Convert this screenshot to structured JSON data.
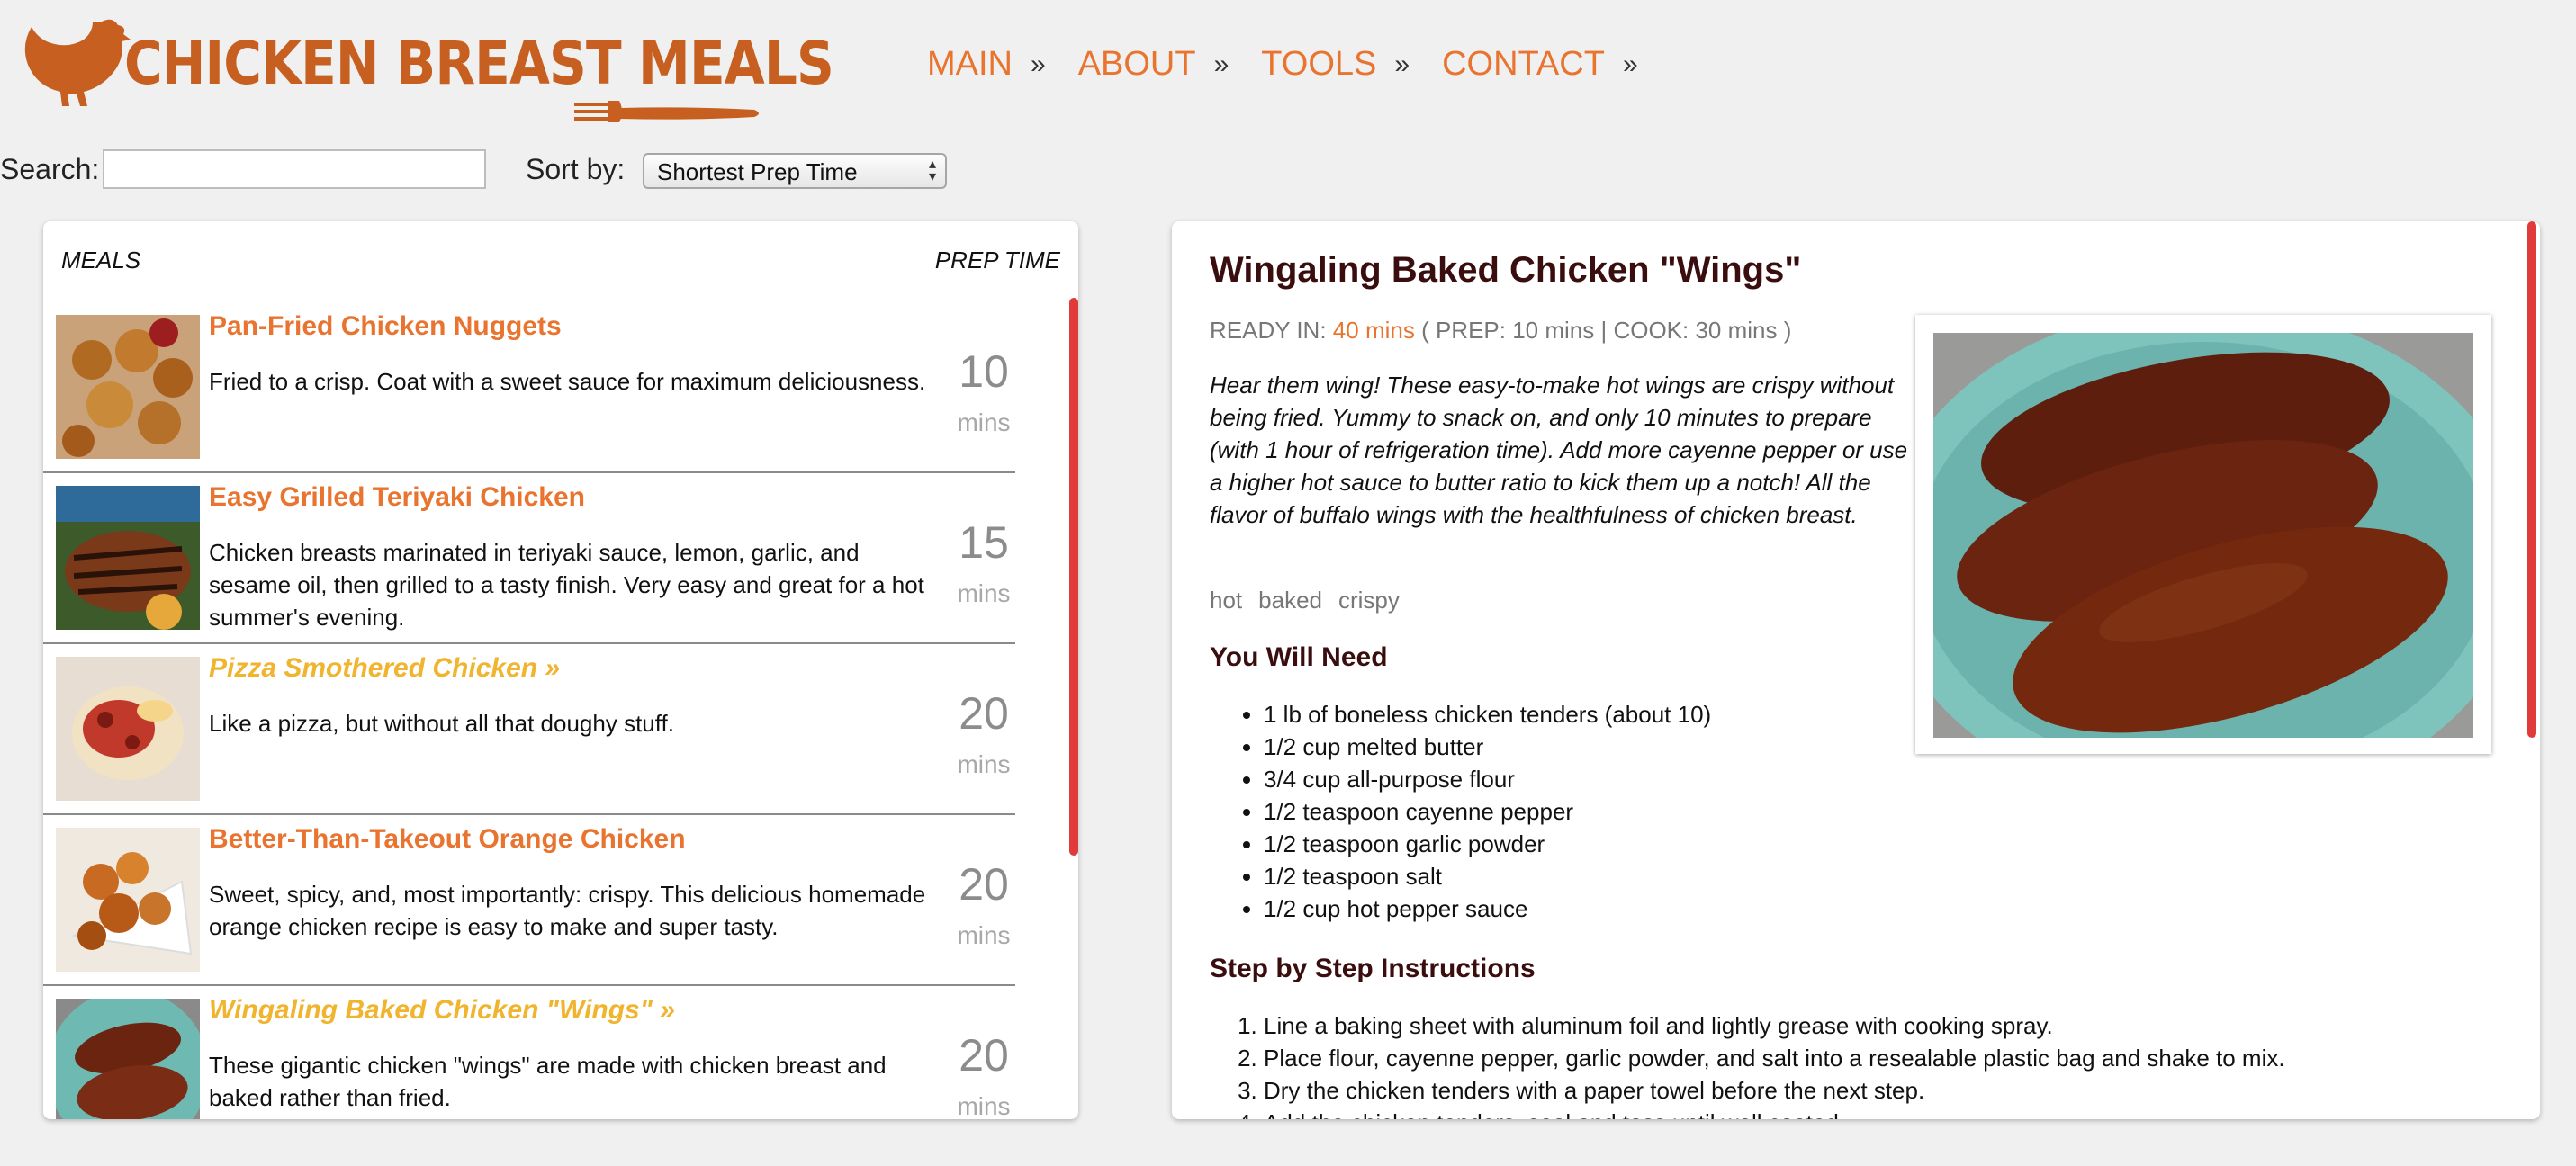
{
  "header": {
    "logo_text": "CHICKEN BREAST MEALS",
    "brand_color": "#c65f1f",
    "nav": [
      {
        "label": "MAIN",
        "sep": "»"
      },
      {
        "label": "ABOUT",
        "sep": "»"
      },
      {
        "label": "TOOLS",
        "sep": "»"
      },
      {
        "label": "CONTACT",
        "sep": "»"
      }
    ]
  },
  "controls": {
    "search_label": "Search:",
    "search_value": "",
    "sort_label": "Sort by:",
    "sort_value": "Shortest Prep Time"
  },
  "meals": {
    "col_meals": "MEALS",
    "col_prep": "PREP TIME",
    "items": [
      {
        "title": "Pan-Fried Chicken Nuggets",
        "desc": "Fried to a crisp. Coat with a sweet sauce for maximum deliciousness.",
        "prep": "10",
        "unit": "mins"
      },
      {
        "title": "Easy Grilled Teriyaki Chicken",
        "desc": "Chicken breasts marinated in teriyaki sauce, lemon, garlic, and sesame oil, then grilled to a tasty finish. Very easy and great for a hot summer's evening.",
        "prep": "15",
        "unit": "mins"
      },
      {
        "title": "Pizza Smothered Chicken »",
        "desc": "Like a pizza, but without all that doughy stuff.",
        "prep": "20",
        "unit": "mins"
      },
      {
        "title": "Better-Than-Takeout Orange Chicken",
        "desc": "Sweet, spicy, and, most importantly: crispy. This delicious homemade orange chicken recipe is easy to make and super tasty.",
        "prep": "20",
        "unit": "mins"
      },
      {
        "title": "Wingaling Baked Chicken \"Wings\" »",
        "desc": "These gigantic chicken \"wings\" are made with chicken breast and baked rather than fried.",
        "prep": "20",
        "unit": "mins"
      }
    ]
  },
  "detail": {
    "title": "Wingaling Baked Chicken \"Wings\"",
    "ready_label": "READY IN:",
    "ready_total": "40 mins",
    "ready_breakdown": "( PREP: 10 mins | COOK: 30 mins )",
    "intro": "Hear them wing! These easy-to-make hot wings are crispy without being fried. Yummy to snack on, and only 10 minutes to prepare (with 1 hour of refrigeration time). Add more cayenne pepper or use a higher hot sauce to butter ratio to kick them up a notch! All the flavor of buffalo wings with the healthfulness of chicken breast.",
    "tags": [
      "hot",
      "baked",
      "crispy"
    ],
    "need_heading": "You Will Need",
    "ingredients": [
      "1 lb of boneless chicken tenders (about 10)",
      "1/2 cup melted butter",
      "3/4 cup all-purpose flour",
      "1/2 teaspoon cayenne pepper",
      "1/2 teaspoon garlic powder",
      "1/2 teaspoon salt",
      "1/2 cup hot pepper sauce"
    ],
    "steps_heading": "Step by Step Instructions",
    "steps": [
      "Line a baking sheet with aluminum foil and lightly grease with cooking spray.",
      "Place flour, cayenne pepper, garlic powder, and salt into a resealable plastic bag and shake to mix.",
      "Dry the chicken tenders with a paper towel before the next step.",
      "Add the chicken tenders, seal and toss until well coated."
    ]
  },
  "colors": {
    "accent": "#e8742f",
    "featured": "#f0b42e",
    "scrollbar": "#e03a3a",
    "heading": "#3a0e0e"
  }
}
